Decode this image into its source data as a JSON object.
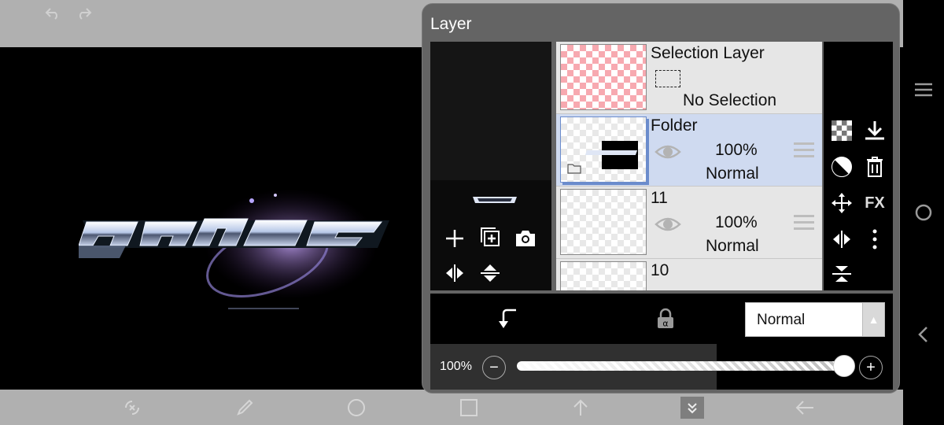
{
  "panel": {
    "title": "Layer"
  },
  "layers": [
    {
      "name": "Selection Layer",
      "type": "selection",
      "status": "No Selection"
    },
    {
      "name": "Folder",
      "type": "folder",
      "opacity": "100%",
      "blend": "Normal",
      "selected": true
    },
    {
      "name": "11",
      "type": "layer",
      "opacity": "100%",
      "blend": "Normal"
    },
    {
      "name": "10",
      "type": "layer"
    }
  ],
  "blend_mode": {
    "selected": "Normal"
  },
  "opacity": {
    "label": "100%",
    "value": 1.0
  },
  "colors": {
    "panel_bg": "#646464",
    "selected_row": "#cfdaf0",
    "selection_checker": "#f7a9b0"
  },
  "icons": {
    "topbar": [
      "undo-icon",
      "redo-icon"
    ],
    "bottombar": [
      "transform-icon",
      "brush-icon",
      "circle-icon",
      "square-icon",
      "arrow-up-icon",
      "collapse-icon",
      "back-arrow-icon"
    ],
    "navbar": [
      "menu-icon",
      "home-circle-icon",
      "back-icon"
    ],
    "preview": [
      "add-layer-icon",
      "duplicate-layer-icon",
      "camera-icon",
      "flip-horizontal-icon",
      "flip-vertical-icon"
    ],
    "side": [
      "checker-icon",
      "download-icon",
      "mask-icon",
      "trash-icon",
      "move-icon",
      "fx-icon",
      "flip-icon",
      "more-icon",
      "merge-down-icon"
    ]
  },
  "side_tools": {
    "fx_label": "FX"
  }
}
